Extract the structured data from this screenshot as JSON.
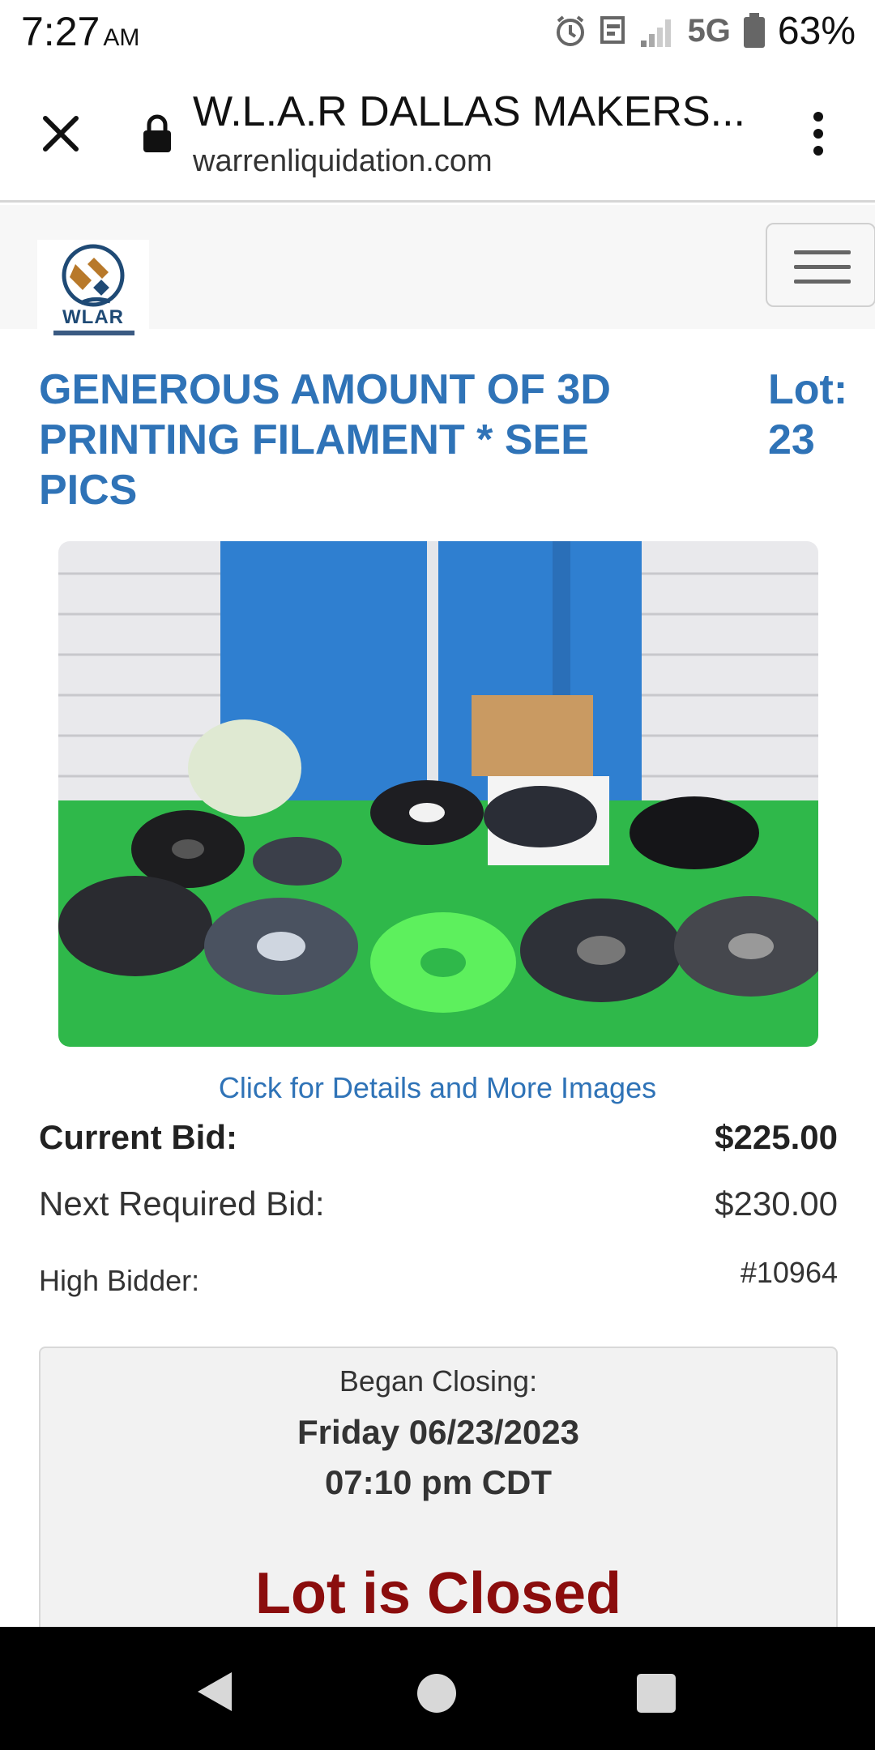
{
  "status_bar": {
    "time": "7:27",
    "ampm": "AM",
    "network": "5G",
    "battery": "63%",
    "icons": [
      "alarm-icon",
      "notification-icon",
      "signal-icon",
      "battery-icon"
    ]
  },
  "browser": {
    "page_title": "W.L.A.R DALLAS MAKERS...",
    "url": "warrenliquidation.com",
    "icons": [
      "close-icon",
      "lock-icon",
      "more-vert-icon"
    ]
  },
  "site": {
    "logo_text": "WLAR",
    "menu_icon": "hamburger-icon"
  },
  "lot": {
    "title": "GENEROUS AMOUNT OF 3D PRINTING FILAMENT * SEE PICS",
    "lot_label": "Lot:",
    "lot_number": "23",
    "details_link": "Click for Details and More Images"
  },
  "bids": {
    "current_label": "Current Bid:",
    "current_value": "$225.00",
    "next_label": "Next Required Bid:",
    "next_value": "$230.00",
    "high_label": "High Bidder:",
    "high_value": "#10964"
  },
  "closing": {
    "began_label": "Began Closing:",
    "date": "Friday 06/23/2023",
    "time": "07:10 pm CDT",
    "status": "Lot is Closed"
  },
  "colors": {
    "link_blue": "#2f73b7",
    "closed_red": "#8b0d0d"
  },
  "nav": {
    "icons": [
      "back-icon",
      "home-icon",
      "recents-icon"
    ]
  }
}
